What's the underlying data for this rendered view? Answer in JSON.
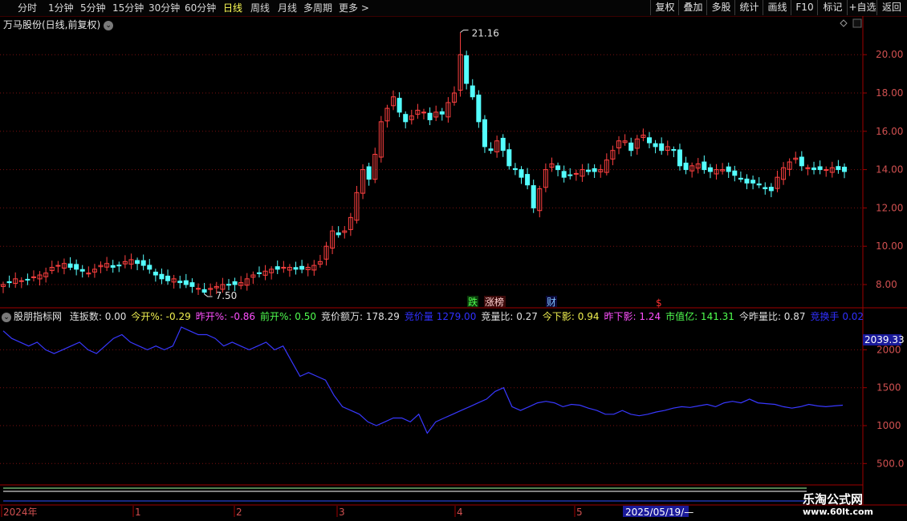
{
  "toolbar": {
    "periods": [
      "分时",
      "1分钟",
      "5分钟",
      "15分钟",
      "30分钟",
      "60分钟",
      "日线",
      "周线",
      "月线",
      "多周期",
      "更多 >"
    ],
    "active_period": "日线",
    "right_buttons": [
      "复权",
      "叠加",
      "多股",
      "统计",
      "画线",
      "F10",
      "标记",
      "+自选",
      "返回"
    ]
  },
  "stock": {
    "title": "万马股份(日线,前复权)"
  },
  "price_axis": {
    "ticks": [
      "20.00",
      "18.00",
      "16.00",
      "14.00",
      "12.00",
      "10.00",
      "8.00"
    ]
  },
  "annotations": {
    "high": "21.16",
    "low": "7.50"
  },
  "event_markers": {
    "die": "跌",
    "zhangbang": "涨榜",
    "cai": "财",
    "dollar": "$"
  },
  "indicator": {
    "name": "股朋指标网",
    "items": [
      {
        "label": "连扳数:",
        "value": "0.00",
        "color": "#e0e0e0"
      },
      {
        "label": "今开%:",
        "value": "-0.29",
        "color": "#f0f050"
      },
      {
        "label": "昨开%:",
        "value": "-0.86",
        "color": "#ff50ff"
      },
      {
        "label": "前开%:",
        "value": "0.50",
        "color": "#50ff50"
      },
      {
        "label": "竞价额万:",
        "value": "178.29",
        "color": "#e0e0e0"
      },
      {
        "label": "竞价量",
        "value": "1279.00",
        "color": "#3030ff"
      },
      {
        "label": "竞量比:",
        "value": "0.27",
        "color": "#e0e0e0"
      },
      {
        "label": "今下影:",
        "value": "0.94",
        "color": "#f0f050"
      },
      {
        "label": "昨下影:",
        "value": "1.24",
        "color": "#ff50ff"
      },
      {
        "label": "市值亿:",
        "value": "141.31",
        "color": "#50ff50"
      },
      {
        "label": "今昨量比:",
        "value": "0.87",
        "color": "#e0e0e0"
      },
      {
        "label": "竞换手",
        "value": "0.02",
        "color": "#3030ff"
      }
    ],
    "current_value": "2039.33",
    "axis_ticks": [
      "2000",
      "1500",
      "1000",
      "500.0"
    ]
  },
  "timeline": {
    "labels": [
      "2024年",
      "1",
      "2",
      "3",
      "4",
      "5"
    ],
    "cursor_date": "2025/05/19/—"
  },
  "watermark": {
    "title": "乐淘公式网",
    "url": "www.60lt.com"
  },
  "chart_data": {
    "type": "candlestick",
    "title": "万马股份(日线,前复权)",
    "y_range": [
      7.0,
      21.5
    ],
    "y_ticks": [
      8,
      10,
      12,
      14,
      16,
      18,
      20
    ],
    "labels": {
      "max": 21.16,
      "min": 7.5
    },
    "closes": [
      8.0,
      8.1,
      8.3,
      8.2,
      8.25,
      8.4,
      8.5,
      8.6,
      8.9,
      9.0,
      9.1,
      8.9,
      8.8,
      8.7,
      8.6,
      8.8,
      9.0,
      9.1,
      8.9,
      9.0,
      9.2,
      9.3,
      9.1,
      9.0,
      8.8,
      8.5,
      8.3,
      8.2,
      8.3,
      8.1,
      8.0,
      7.9,
      7.8,
      7.6,
      7.8,
      7.9,
      8.0,
      8.0,
      8.0,
      8.1,
      8.3,
      8.5,
      8.6,
      8.7,
      8.8,
      8.8,
      8.9,
      8.9,
      8.8,
      8.8,
      8.9,
      9.0,
      9.2,
      10.0,
      10.8,
      10.6,
      10.8,
      11.5,
      12.8,
      14.0,
      13.5,
      14.8,
      16.5,
      17.2,
      17.8,
      17.0,
      16.5,
      16.8,
      17.1,
      17.0,
      16.6,
      17.0,
      16.9,
      17.5,
      18.0,
      20.0,
      18.5,
      17.8,
      16.5,
      15.2,
      15.0,
      15.5,
      15.0,
      14.2,
      14.0,
      13.6,
      13.2,
      12.0,
      13.0,
      14.0,
      14.3,
      14.0,
      13.6,
      13.7,
      13.8,
      14.0,
      13.9,
      13.9,
      14.0,
      14.5,
      15.0,
      15.5,
      15.5,
      15.0,
      15.6,
      15.8,
      15.4,
      15.2,
      15.0,
      15.2,
      15.0,
      14.2,
      14.0,
      14.2,
      14.3,
      14.0,
      13.9,
      14.0,
      14.0,
      13.9,
      13.7,
      13.5,
      13.3,
      13.3,
      13.2,
      13.0,
      12.9,
      13.6,
      14.1,
      14.4,
      14.6,
      14.2,
      14.1,
      14.0,
      14.0,
      14.0,
      14.1,
      14.0,
      13.9
    ],
    "indicator_series": {
      "name": "股朋指标网",
      "y_range": [
        330,
        2400
      ],
      "values": [
        2250,
        2150,
        2100,
        2050,
        2100,
        2000,
        1950,
        2000,
        2050,
        2100,
        2000,
        1950,
        2050,
        2150,
        2200,
        2100,
        2050,
        2000,
        2050,
        2000,
        2050,
        2300,
        2250,
        2200,
        2200,
        2150,
        2050,
        2100,
        2050,
        2000,
        2050,
        2100,
        2000,
        2050,
        1850,
        1650,
        1700,
        1650,
        1600,
        1400,
        1250,
        1200,
        1150,
        1050,
        1000,
        1050,
        1100,
        1100,
        1050,
        1150,
        900,
        1050,
        1100,
        1150,
        1200,
        1250,
        1300,
        1350,
        1450,
        1500,
        1250,
        1200,
        1250,
        1300,
        1320,
        1300,
        1250,
        1280,
        1270,
        1230,
        1200,
        1150,
        1150,
        1200,
        1150,
        1130,
        1150,
        1180,
        1200,
        1230,
        1250,
        1240,
        1260,
        1280,
        1250,
        1300,
        1320,
        1300,
        1350,
        1300,
        1290,
        1280,
        1250,
        1230,
        1250,
        1280,
        1260,
        1250,
        1260,
        1270
      ]
    }
  }
}
